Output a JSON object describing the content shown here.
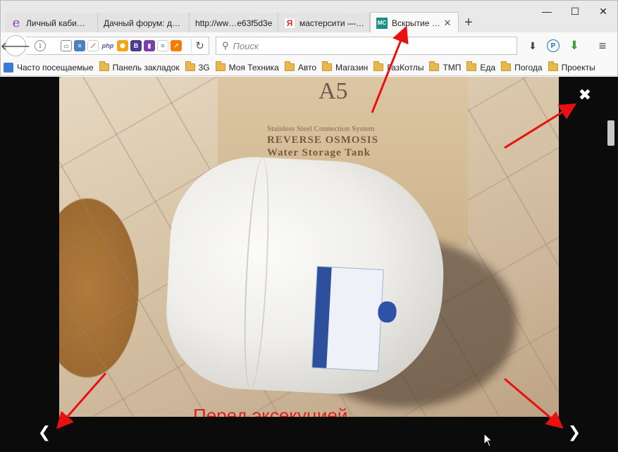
{
  "window": {
    "minimize_icon": "minimize-icon",
    "maximize_icon": "maximize-icon",
    "close_icon": "close-icon"
  },
  "tabs": [
    {
      "title": "Личный каби…",
      "favicon": "e",
      "favicon_color": "#8c3db3",
      "active": false
    },
    {
      "title": "Дачный форум: д…",
      "favicon": "",
      "active": false
    },
    {
      "title": "http://ww…e63f5d3e",
      "favicon": "",
      "active": false
    },
    {
      "title": "мастерсити —…",
      "favicon": "Я",
      "favicon_color": "#d32f2f",
      "active": false
    },
    {
      "title": "Вскрытие …",
      "favicon": "MC",
      "favicon_color": "#1a8f86",
      "active": true
    }
  ],
  "navbar": {
    "search_placeholder": "Поиск",
    "addons": [
      "reader-icon",
      "notes-icon",
      "chart-icon",
      "php-icon",
      "shield-icon",
      "b-icon",
      "book-icon",
      "wave-icon",
      "graph-icon"
    ],
    "php_label": "php",
    "b_label": "B"
  },
  "bookmarks": [
    {
      "label": "Часто посещаемые",
      "type": "star"
    },
    {
      "label": "Панель закладок",
      "type": "folder"
    },
    {
      "label": "3G",
      "type": "folder"
    },
    {
      "label": "Моя Техника",
      "type": "folder"
    },
    {
      "label": "Авто",
      "type": "folder"
    },
    {
      "label": "Магазин",
      "type": "folder"
    },
    {
      "label": "ГазКотлы",
      "type": "folder"
    },
    {
      "label": "ТМП",
      "type": "folder"
    },
    {
      "label": "Еда",
      "type": "folder"
    },
    {
      "label": "Погода",
      "type": "folder"
    },
    {
      "label": "Проекты",
      "type": "folder"
    }
  ],
  "photo": {
    "box_mark": "A5",
    "box_line1": "Stainless Steel Connection System",
    "box_line2": "REVERSE OSMOSIS",
    "box_line3": "Water Storage Tank",
    "caption": "Перед эксекуцией"
  },
  "lightbox": {
    "close_symbol": "✖",
    "prev_symbol": "❮",
    "next_symbol": "❯"
  },
  "colors": {
    "arrow": "#e81010",
    "lightbox_bg": "#0b0b0b"
  }
}
